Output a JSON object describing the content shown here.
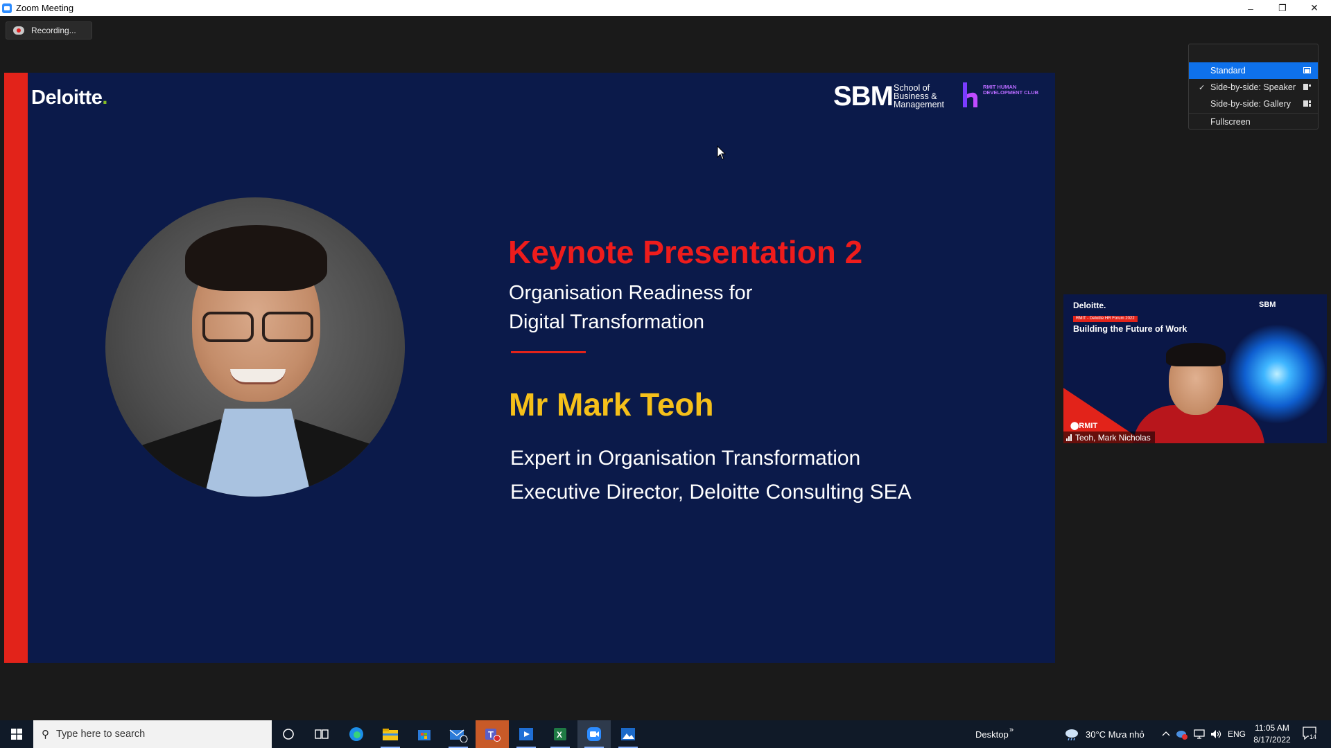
{
  "window": {
    "title": "Zoom Meeting",
    "controls": [
      "–",
      "❐",
      "✕"
    ]
  },
  "recording": {
    "label": "Recording..."
  },
  "slide": {
    "logo_left": "Deloitte",
    "logo_left_dot": ".",
    "logo_sbm": "SBM",
    "logo_sbm_sub": "School of Business & Management",
    "logo_club": "RMIT HUMAN DEVELOPMENT CLUB",
    "title": "Keynote Presentation 2",
    "subtitle_line1": "Organisation Readiness for",
    "subtitle_line2": "Digital Transformation",
    "speaker_name": "Mr Mark Teoh",
    "role_line1": "Expert in Organisation Transformation",
    "role_line2": "Executive Director, Deloitte Consulting SEA"
  },
  "layout_menu": {
    "items": [
      {
        "label": "Standard",
        "selected": true,
        "checked": false
      },
      {
        "label": "Side-by-side: Speaker",
        "selected": false,
        "checked": true
      },
      {
        "label": "Side-by-side: Gallery",
        "selected": false,
        "checked": false
      },
      {
        "label": "Fullscreen",
        "selected": false,
        "checked": false
      }
    ],
    "check_glyph": "✓"
  },
  "thumbnail": {
    "logo": "Deloitte.",
    "logo_right": "SBM",
    "badge": "RMIT - Deloitte HR Forum 2022",
    "headline": "Building the Future of Work",
    "footer_logo": "⬤RMIT",
    "participant_name": "Teoh, Mark Nicholas"
  },
  "taskbar": {
    "search_placeholder": "Type here to search",
    "desktop_label": "Desktop",
    "desktop_chevron": "»",
    "weather": "30°C  Mưa nhỏ",
    "language": "ENG",
    "time": "11:05 AM",
    "date": "8/17/2022",
    "notification_count": "14"
  },
  "colors": {
    "slide_bg": "#0b1a4a",
    "accent_red": "#e2231a",
    "speaker_yellow": "#f5c01a",
    "menu_selected": "#0e71eb"
  }
}
